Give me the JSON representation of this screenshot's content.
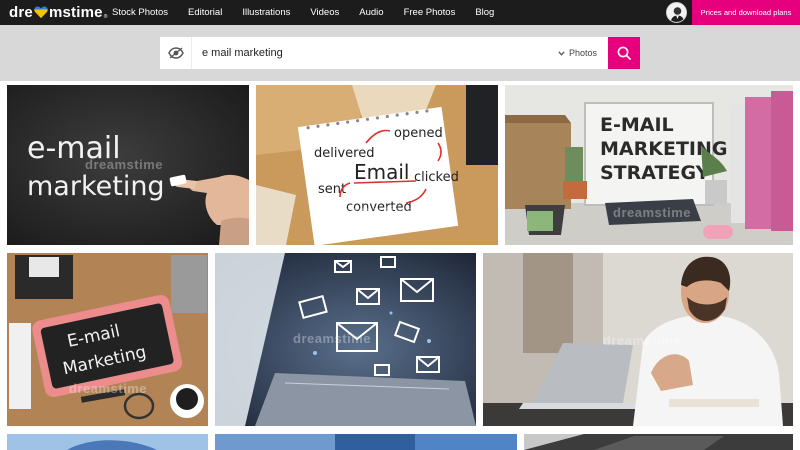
{
  "nav": {
    "logo_left": "dre",
    "logo_right": "mstime",
    "logo_reg": "®",
    "links": [
      "Stock Photos",
      "Editorial",
      "Illustrations",
      "Videos",
      "Audio",
      "Free Photos",
      "Blog"
    ],
    "pricing_label": "Prices and download plans"
  },
  "search": {
    "query": "e mail marketing",
    "content_type": "Photos"
  },
  "results": {
    "watermark": "dreamstime",
    "tile1": {
      "line1": "e-mail",
      "line2": "marketing"
    },
    "tile2": {
      "w1": "delivered",
      "w2": "opened",
      "w3": "Email",
      "w4": "sent",
      "w5": "clicked",
      "w6": "converted"
    },
    "tile3": {
      "line1": "E-MAIL",
      "line2": "MARKETING",
      "line3": "STRATEGY"
    },
    "tile4": {
      "line1": "E-mail",
      "line2": "Marketing"
    }
  },
  "colors": {
    "nav_bg": "#1c1c1c",
    "accent": "#e6007e",
    "search_band": "#d8d8d8"
  }
}
